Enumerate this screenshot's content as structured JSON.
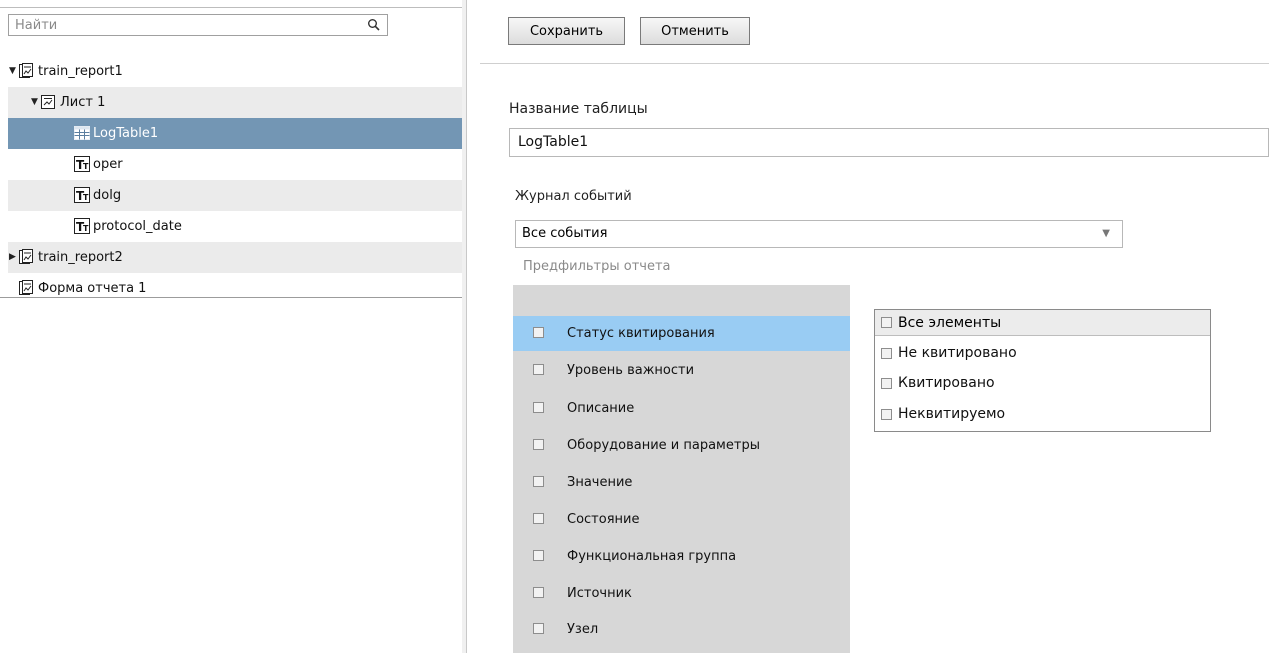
{
  "search": {
    "placeholder": "Найти"
  },
  "tree": {
    "items": [
      {
        "label": "train_report1",
        "arrow": "▼",
        "icon": "report-icon"
      },
      {
        "label": "Лист 1",
        "arrow": "▼",
        "icon": "sheet-icon"
      },
      {
        "label": "LogTable1",
        "arrow": "",
        "icon": "table-icon",
        "selected": true
      },
      {
        "label": "oper",
        "arrow": "",
        "icon": "text-field-icon"
      },
      {
        "label": "dolg",
        "arrow": "",
        "icon": "text-field-icon"
      },
      {
        "label": "protocol_date",
        "arrow": "",
        "icon": "text-field-icon"
      },
      {
        "label": "train_report2",
        "arrow": "▶",
        "icon": "report-icon"
      },
      {
        "label": "Форма отчета 1",
        "arrow": "",
        "icon": "report-icon"
      }
    ]
  },
  "toolbar": {
    "save_label": "Сохранить",
    "cancel_label": "Отменить"
  },
  "form": {
    "table_name_label": "Название таблицы",
    "table_name_value": "LogTable1",
    "event_log_label": "Журнал событий",
    "event_log_value": "Все события",
    "prefilters_label": "Предфильтры отчета"
  },
  "filters": [
    {
      "label": "Статус квитирования",
      "selected": true
    },
    {
      "label": "Уровень важности"
    },
    {
      "label": "Описание"
    },
    {
      "label": "Оборудование и параметры"
    },
    {
      "label": "Значение"
    },
    {
      "label": "Состояние"
    },
    {
      "label": "Функциональная группа"
    },
    {
      "label": "Источник"
    },
    {
      "label": "Узел"
    }
  ],
  "values": {
    "header": "Все элементы",
    "items": [
      "Не квитировано",
      "Квитировано",
      "Неквитируемо"
    ]
  },
  "colors": {
    "selection_tree": "#7396b4",
    "selection_filter": "#99ccf3",
    "filter_bg": "#d7d7d7"
  }
}
